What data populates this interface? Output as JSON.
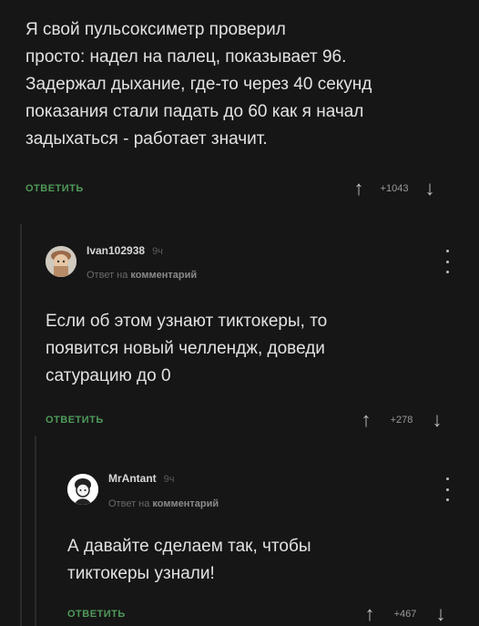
{
  "comments": [
    {
      "text": "Я свой пульсоксиметр проверил\nпросто: надел на палец, показывает 96.\nЗадержал дыхание, где-то через 40 секунд\nпоказания стали падать до 60 как я начал\nзадыхаться - работает значит.",
      "reply_label": "ОТВЕТИТЬ",
      "score": "+1043"
    },
    {
      "author": "Ivan102938",
      "time": "9ч",
      "reply_to_prefix": "Ответ на",
      "reply_to_target": "комментарий",
      "text": "Если об этом узнают тиктокеры, то\nпоявится новый челлендж, доведи\nсатурацию до 0",
      "reply_label": "ОТВЕТИТЬ",
      "score": "+278"
    },
    {
      "author": "MrAntant",
      "time": "9ч",
      "reply_to_prefix": "Ответ на",
      "reply_to_target": "комментарий",
      "text": "А давайте сделаем так, чтобы\nтиктокеры узнали!",
      "reply_label": "ОТВЕТИТЬ",
      "score": "+467"
    }
  ],
  "icons": {
    "upvote": "↑",
    "downvote": "↓",
    "more": "more-vertical-icon",
    "avatar_1": "avatar-image",
    "avatar_2": "avatar-image"
  },
  "colors": {
    "background": "#161616",
    "text": "#e2e2e2",
    "reply": "#4f9a5a",
    "meta": "#6a6a6a"
  }
}
